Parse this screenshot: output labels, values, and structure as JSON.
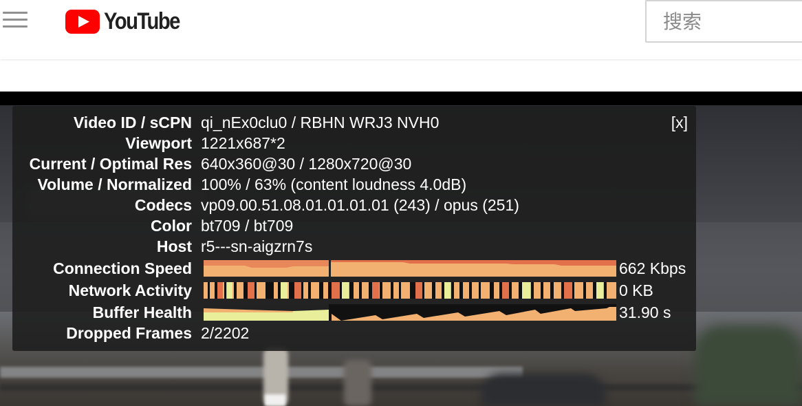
{
  "header": {
    "logo_text": "YouTube",
    "search_placeholder": "搜索"
  },
  "stats": {
    "close_label": "[x]",
    "rows": [
      {
        "label": "Video ID / sCPN",
        "value": "qi_nEx0clu0 / RBHN WRJ3 NVH0"
      },
      {
        "label": "Viewport",
        "value": "1221x687*2"
      },
      {
        "label": "Current / Optimal Res",
        "value": "640x360@30 / 1280x720@30"
      },
      {
        "label": "Volume / Normalized",
        "value": "100% / 63% (content loudness 4.0dB)"
      },
      {
        "label": "Codecs",
        "value": "vp09.00.51.08.01.01.01.01 (243) / opus (251)"
      },
      {
        "label": "Color",
        "value": "bt709 / bt709"
      },
      {
        "label": "Host",
        "value": "r5---sn-aigzrn7s"
      }
    ],
    "graphs": [
      {
        "label": "Connection Speed",
        "value": "662 Kbps"
      },
      {
        "label": "Network Activity",
        "value": "0 KB"
      },
      {
        "label": "Buffer Health",
        "value": "31.90 s"
      }
    ],
    "dropped": {
      "label": "Dropped Frames",
      "value": "2/2202"
    }
  },
  "colors": {
    "brand_red": "#ff0000",
    "graph_base": "#f2b170",
    "graph_accent": "#e2704a",
    "graph_light": "#e8ee9a",
    "panel_bg": "#1c1c1c"
  }
}
